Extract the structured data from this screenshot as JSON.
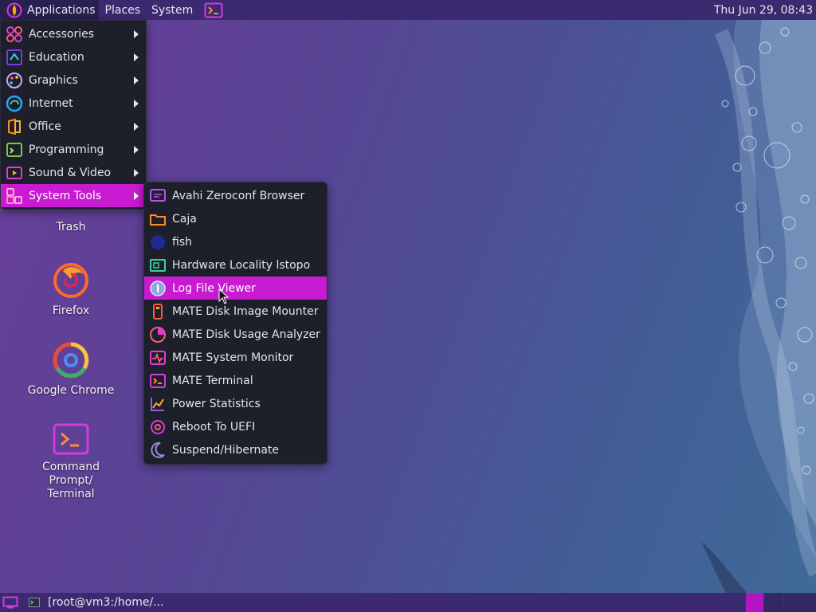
{
  "top_panel": {
    "menus": [
      {
        "label": "Applications",
        "icon": "mate-menu-icon"
      },
      {
        "label": "Places"
      },
      {
        "label": "System"
      }
    ],
    "launcher_icon": "terminal-launcher-icon",
    "clock": "Thu Jun 29, 08:43"
  },
  "applications_menu": {
    "items": [
      {
        "label": "Accessories",
        "icon": "accessories-icon",
        "has_submenu": true
      },
      {
        "label": "Education",
        "icon": "education-icon",
        "has_submenu": true
      },
      {
        "label": "Graphics",
        "icon": "graphics-icon",
        "has_submenu": true
      },
      {
        "label": "Internet",
        "icon": "internet-icon",
        "has_submenu": true
      },
      {
        "label": "Office",
        "icon": "office-icon",
        "has_submenu": true
      },
      {
        "label": "Programming",
        "icon": "programming-icon",
        "has_submenu": true
      },
      {
        "label": "Sound & Video",
        "icon": "sound-video-icon",
        "has_submenu": true
      },
      {
        "label": "System Tools",
        "icon": "system-tools-icon",
        "has_submenu": true,
        "selected": true
      }
    ]
  },
  "system_tools_menu": {
    "items": [
      {
        "label": "Avahi Zeroconf Browser",
        "icon": "avahi-browser-icon"
      },
      {
        "label": "Caja",
        "icon": "folder-icon"
      },
      {
        "label": "fish",
        "icon": "fish-icon"
      },
      {
        "label": "Hardware Locality lstopo",
        "icon": "hardware-locality-icon"
      },
      {
        "label": "Log File Viewer",
        "icon": "log-viewer-icon",
        "highlighted": true
      },
      {
        "label": "MATE Disk Image Mounter",
        "icon": "disk-mounter-icon"
      },
      {
        "label": "MATE Disk Usage Analyzer",
        "icon": "disk-usage-icon"
      },
      {
        "label": "MATE System Monitor",
        "icon": "system-monitor-icon"
      },
      {
        "label": "MATE Terminal",
        "icon": "terminal-icon"
      },
      {
        "label": "Power Statistics",
        "icon": "power-statistics-icon"
      },
      {
        "label": "Reboot To UEFI",
        "icon": "reboot-icon"
      },
      {
        "label": "Suspend/Hibernate",
        "icon": "moon-icon"
      }
    ]
  },
  "desktop_icons": [
    {
      "label": "Trash",
      "icon": "trash-icon"
    },
    {
      "label": "Firefox",
      "icon": "firefox-icon"
    },
    {
      "label": "Google Chrome",
      "icon": "chrome-icon"
    },
    {
      "label": "Command Prompt/ Terminal",
      "icon": "terminal-icon"
    }
  ],
  "bottom_panel": {
    "show_desktop_icon": "show-desktop-icon",
    "task": {
      "label": "[root@vm3:/home/...",
      "icon": "terminal-icon"
    }
  },
  "colors": {
    "panel": "#3b2a6f",
    "menu_bg": "#1d1f2b",
    "highlight": "#c81ad0"
  }
}
